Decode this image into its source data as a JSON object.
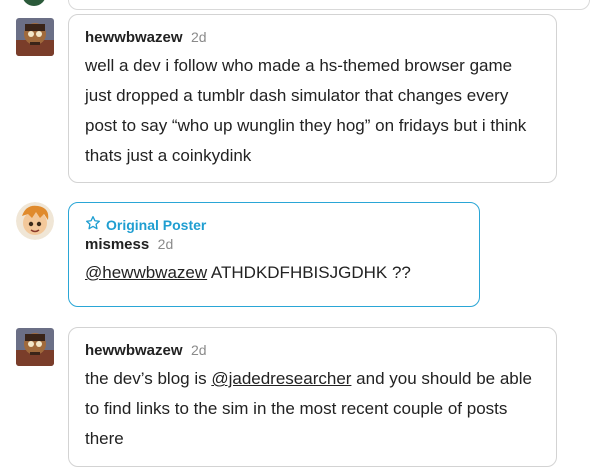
{
  "thread": {
    "posts": [
      {
        "username": "hewwbwazew",
        "time": "2d",
        "text": "well a dev i follow who made a hs-themed browser game just dropped a tumblr dash simulator that changes every post to say “who up wunglin they hog” on fridays but i think thats just a coinkydink"
      },
      {
        "badge": "Original Poster",
        "username": "mismess",
        "time": "2d",
        "mention": "@hewwbwazew",
        "text": " ATHDKDFHBISJGDHK ??"
      },
      {
        "username": "hewwbwazew",
        "time": "2d",
        "text_before": "the dev’s blog is ",
        "mention": "@jadedresearcher",
        "text_after": " and you should be able to find links to the sim in the most recent couple of posts there"
      }
    ]
  },
  "colors": {
    "op_accent": "#1f9ed1",
    "border": "#d3d3d3"
  },
  "icons": {
    "op_badge": "star-outline-icon"
  }
}
